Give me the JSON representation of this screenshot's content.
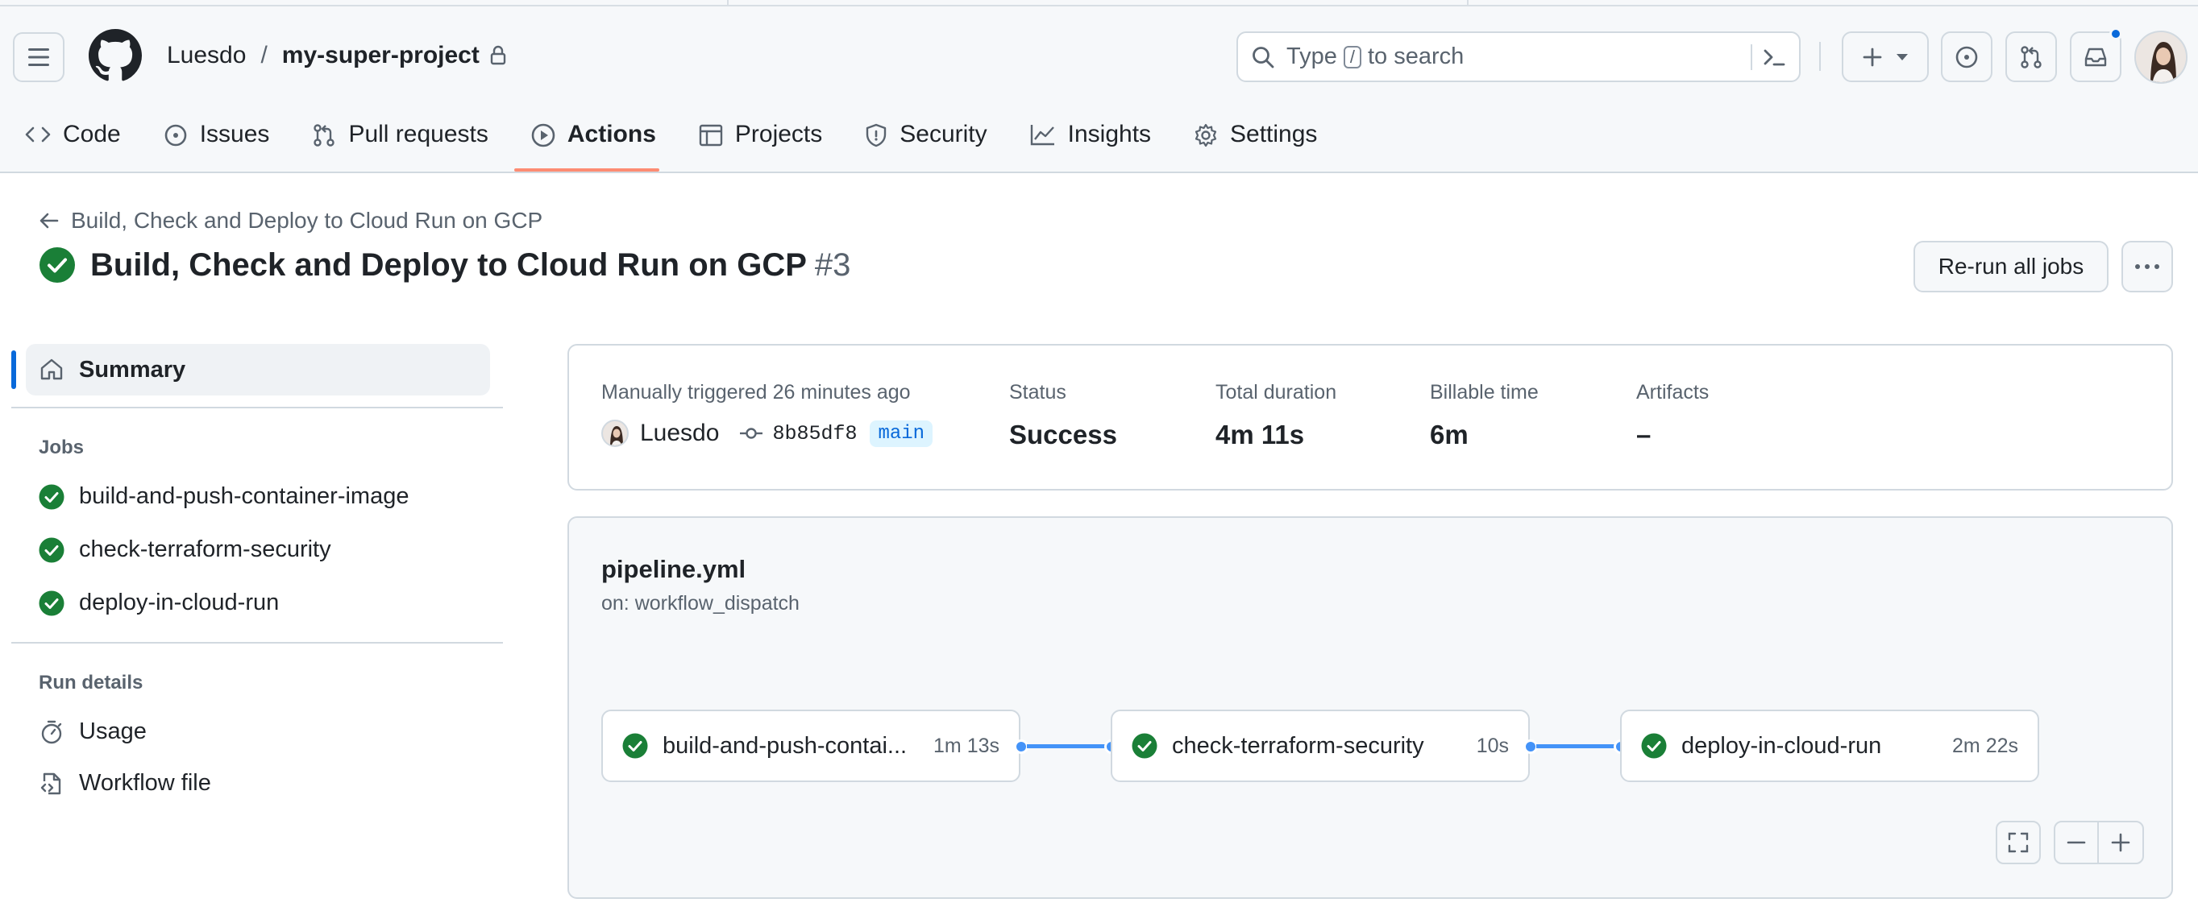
{
  "header": {
    "owner": "Luesdo",
    "separator": "/",
    "repo": "my-super-project",
    "search": {
      "prefix": "Type",
      "key": "/",
      "suffix": "to search"
    }
  },
  "repo_nav": [
    {
      "label": "Code",
      "icon": "code-icon"
    },
    {
      "label": "Issues",
      "icon": "issue-icon"
    },
    {
      "label": "Pull requests",
      "icon": "pull-request-icon"
    },
    {
      "label": "Actions",
      "icon": "play-icon",
      "selected": true
    },
    {
      "label": "Projects",
      "icon": "table-icon"
    },
    {
      "label": "Security",
      "icon": "shield-icon"
    },
    {
      "label": "Insights",
      "icon": "graph-icon"
    },
    {
      "label": "Settings",
      "icon": "gear-icon"
    }
  ],
  "run": {
    "back_link": "Build, Check and Deploy to Cloud Run on GCP",
    "title": "Build, Check and Deploy to Cloud Run on GCP",
    "number": "#3",
    "rerun_label": "Re-run all jobs"
  },
  "sidebar": {
    "summary_label": "Summary",
    "jobs_heading": "Jobs",
    "jobs": [
      {
        "label": "build-and-push-container-image",
        "status": "success"
      },
      {
        "label": "check-terraform-security",
        "status": "success"
      },
      {
        "label": "deploy-in-cloud-run",
        "status": "success"
      }
    ],
    "run_details_heading": "Run details",
    "run_details": [
      {
        "label": "Usage",
        "icon": "stopwatch-icon"
      },
      {
        "label": "Workflow file",
        "icon": "file-code-icon"
      }
    ]
  },
  "summary": {
    "trigger_label": "Manually triggered 26 minutes ago",
    "actor": "Luesdo",
    "commit": "8b85df8",
    "branch": "main",
    "status_label": "Status",
    "status_value": "Success",
    "duration_label": "Total duration",
    "duration_value": "4m 11s",
    "billable_label": "Billable time",
    "billable_value": "6m",
    "artifacts_label": "Artifacts",
    "artifacts_value": "–"
  },
  "graph": {
    "workflow_file": "pipeline.yml",
    "trigger": "on: workflow_dispatch",
    "jobs": [
      {
        "label": "build-and-push-contai...",
        "duration": "1m 13s"
      },
      {
        "label": "check-terraform-security",
        "duration": "10s"
      },
      {
        "label": "deploy-in-cloud-run",
        "duration": "2m 22s"
      }
    ]
  },
  "colors": {
    "success": "#1a7f37",
    "accent": "#0969da",
    "nav_underline": "#fd8c73",
    "connector": "#4493f8"
  }
}
